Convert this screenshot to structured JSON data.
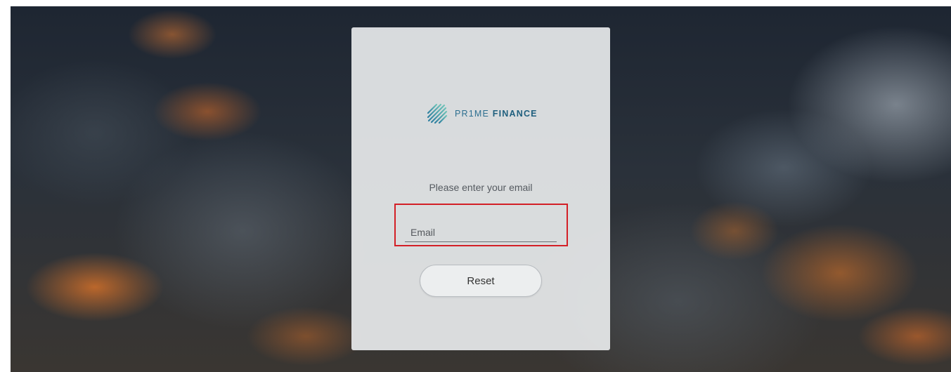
{
  "brand": {
    "name_light": "PR1ME",
    "name_bold": "FINANCE",
    "logo_icon": "diagonal-stripes-logo-icon",
    "color": "#2d6f90"
  },
  "form": {
    "prompt": "Please enter your email",
    "email_placeholder": "Email",
    "email_value": "",
    "reset_label": "Reset",
    "highlight_color": "#d31f26"
  }
}
